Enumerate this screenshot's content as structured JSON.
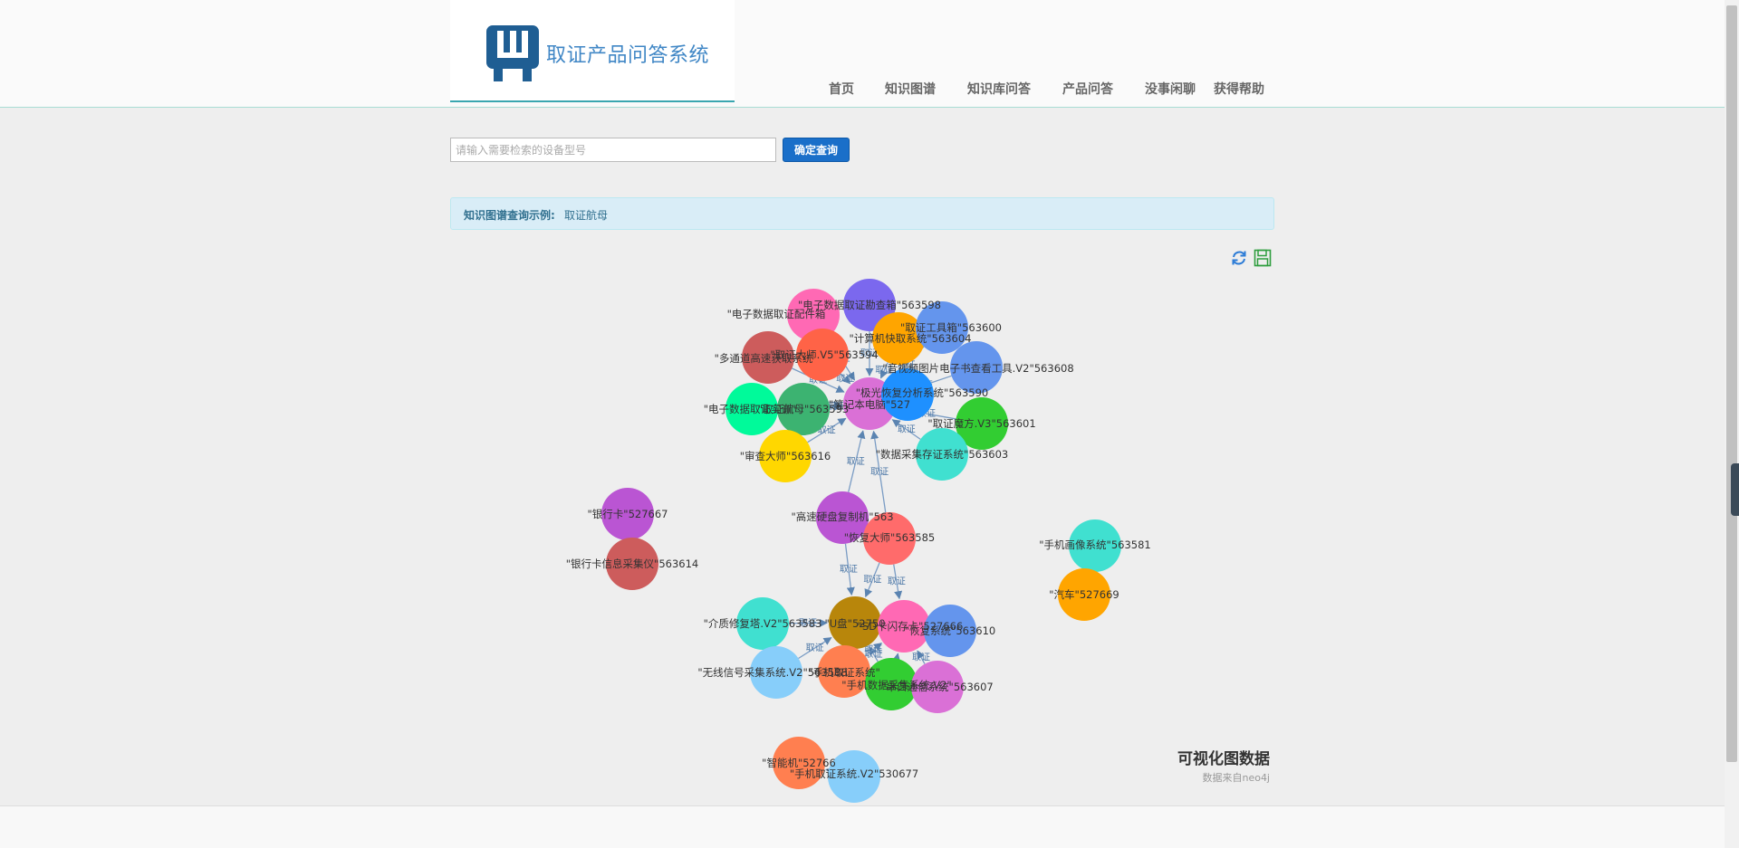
{
  "header": {
    "logo_text": "取证产品问答系统",
    "nav": [
      "首页",
      "知识图谱",
      "知识库问答",
      "产品问答",
      "没事闲聊",
      "获得帮助"
    ]
  },
  "search": {
    "placeholder": "请输入需要检索的设备型号",
    "value": "",
    "button_label": "确定查询"
  },
  "example": {
    "label": "知识图谱查询示例:",
    "link": "取证航母"
  },
  "toolbar": {
    "refresh_icon": "refresh-icon",
    "save_icon": "save-icon"
  },
  "visualization": {
    "title": "可视化图数据",
    "subtitle": "数据来自neo4j"
  },
  "graph": {
    "edge_label": "取证",
    "nodes": [
      {
        "id": "c1",
        "label": "\"笔记本电脑\"527",
        "color": "#da70d6"
      },
      {
        "id": "n1",
        "label": "\"电子数据取证勘查箱\"563598",
        "color": "#7b68ee"
      },
      {
        "id": "n2",
        "label": "\"电子数据取证配件箱",
        "color": "#ff69b4"
      },
      {
        "id": "n3",
        "label": "\"多通道高速获取系统",
        "color": "#cd5c5c"
      },
      {
        "id": "n4",
        "label": "\"取证大师.V5\"563594",
        "color": "#ff6347"
      },
      {
        "id": "n5",
        "label": "\"计算机快取系统\"563604",
        "color": "#ffa500"
      },
      {
        "id": "n6",
        "label": "\"取证工具箱\"563600",
        "color": "#6495ed"
      },
      {
        "id": "n7",
        "label": "\"音视频图片电子书查看工具.V2\"563608",
        "color": "#6495ed"
      },
      {
        "id": "n8",
        "label": "\"极光恢复分析系统\"563590",
        "color": "#1e90ff"
      },
      {
        "id": "n9",
        "label": "\"取证魔方.V3\"563601",
        "color": "#32cd32"
      },
      {
        "id": "n10",
        "label": "\"数据采集存证系统\"563603",
        "color": "#40e0d0"
      },
      {
        "id": "n11",
        "label": "\"电子数据取证实训\"",
        "color": "#00fa9a"
      },
      {
        "id": "n12",
        "label": "\"取证航母\"563593",
        "color": "#3cb371"
      },
      {
        "id": "n13",
        "label": "\"审查大师\"563616",
        "color": "#ffd700"
      },
      {
        "id": "n14",
        "label": "\"高速硬盘复制机\"563",
        "color": "#ba55d3"
      },
      {
        "id": "n15",
        "label": "\"恢复大师\"563585",
        "color": "#ff6b6b"
      },
      {
        "id": "c2",
        "label": "\"U盘\"52750",
        "color": "#b8860b"
      },
      {
        "id": "c3",
        "label": "\"SD卡闪存卡\"527666",
        "color": "#ff69b4"
      },
      {
        "id": "n16",
        "label": "\"介质修复塔.V2\"563583",
        "color": "#40e0d0"
      },
      {
        "id": "n17",
        "label": "\"无线信号采集系统.V2\"563588",
        "color": "#87cefa"
      },
      {
        "id": "n18",
        "label": "\"手机取证系统\"",
        "color": "#ff7f50"
      },
      {
        "id": "n19",
        "label": "\"手机数据采集系统.V2\"",
        "color": "#32cd32"
      },
      {
        "id": "n20",
        "label": "\"串口通信系统\"563607",
        "color": "#da70d6"
      },
      {
        "id": "n21",
        "label": "\"恢复系统\"563610",
        "color": "#6495ed"
      },
      {
        "id": "n22",
        "label": "\"银行卡\"527667",
        "color": "#ba55d3"
      },
      {
        "id": "n23",
        "label": "\"银行卡信息采集仪\"563614",
        "color": "#cd5c5c"
      },
      {
        "id": "n24",
        "label": "\"手机画像系统\"563581",
        "color": "#40e0d0"
      },
      {
        "id": "n25",
        "label": "\"汽车\"527669",
        "color": "#ffa500"
      },
      {
        "id": "n26",
        "label": "\"智能机\"52766",
        "color": "#ff7f50"
      },
      {
        "id": "n27",
        "label": "\"手机取证系统.V2\"530677",
        "color": "#87cefa"
      }
    ],
    "edges": [
      {
        "from": "n1",
        "to": "c1"
      },
      {
        "from": "n2",
        "to": "c1"
      },
      {
        "from": "n3",
        "to": "c1"
      },
      {
        "from": "n4",
        "to": "c1"
      },
      {
        "from": "n5",
        "to": "c1"
      },
      {
        "from": "n6",
        "to": "c1"
      },
      {
        "from": "n7",
        "to": "c1"
      },
      {
        "from": "n8",
        "to": "c1"
      },
      {
        "from": "n9",
        "to": "c1"
      },
      {
        "from": "n10",
        "to": "c1"
      },
      {
        "from": "n11",
        "to": "c1"
      },
      {
        "from": "n12",
        "to": "c1"
      },
      {
        "from": "n13",
        "to": "c1"
      },
      {
        "from": "n14",
        "to": "c1"
      },
      {
        "from": "n15",
        "to": "c1"
      },
      {
        "from": "n14",
        "to": "c2"
      },
      {
        "from": "n15",
        "to": "c2"
      },
      {
        "from": "n15",
        "to": "c3"
      },
      {
        "from": "n16",
        "to": "c2"
      },
      {
        "from": "n17",
        "to": "c2"
      },
      {
        "from": "n18",
        "to": "c2"
      },
      {
        "from": "n19",
        "to": "c2"
      },
      {
        "from": "n20",
        "to": "c3"
      },
      {
        "from": "n21",
        "to": "c3"
      },
      {
        "from": "n18",
        "to": "c3"
      },
      {
        "from": "n19",
        "to": "c3"
      },
      {
        "from": "n23",
        "to": "n22"
      },
      {
        "from": "n25",
        "to": "n24"
      },
      {
        "from": "n27",
        "to": "n26"
      }
    ]
  }
}
